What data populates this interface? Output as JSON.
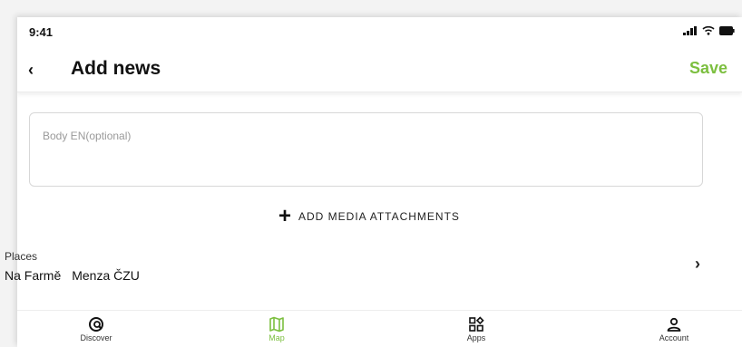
{
  "status_bar": {
    "time": "9:41"
  },
  "header": {
    "back_glyph": "‹",
    "title": "Add news",
    "save_label": "Save"
  },
  "form": {
    "body_placeholder": "Body EN(optional)",
    "add_media_label": "ADD MEDIA ATTACHMENTS"
  },
  "places": {
    "caption": "Places",
    "items": [
      "Na Farmě",
      "Menza ČZU"
    ]
  },
  "tabbar": {
    "tabs": [
      {
        "label": "Discover",
        "icon": "discover-icon",
        "active": false
      },
      {
        "label": "Map",
        "icon": "map-icon",
        "active": true
      },
      {
        "label": "Apps",
        "icon": "apps-icon",
        "active": false
      },
      {
        "label": "Account",
        "icon": "account-icon",
        "active": false
      }
    ]
  },
  "colors": {
    "accent": "#7cbf3f",
    "text": "#111111",
    "placeholder": "#9a9a9a"
  }
}
